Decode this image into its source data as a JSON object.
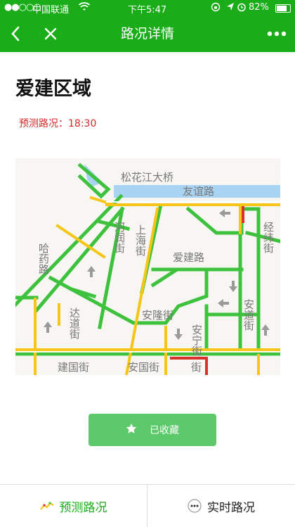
{
  "status_bar": {
    "signal": "●●○○○",
    "carrier": "中国联通",
    "time": "下午5:47",
    "battery": "82%"
  },
  "nav": {
    "title": "路况详情",
    "icons": [
      "back-icon",
      "close-icon",
      "more-icon"
    ]
  },
  "content": {
    "area_title": "爱建区域",
    "forecast_label": "预测路况：",
    "forecast_time": "18:30"
  },
  "map": {
    "labels": {
      "songhuajiang_bridge": "松花江大桥",
      "youyi_road": "友谊路",
      "herun_street": "河润街",
      "shanghai_street": "上海街",
      "aijian_road": "爱建路",
      "jingwei_street": "经纬街",
      "hayao_road": "哈药路",
      "anlong_street": "安隆街",
      "anning_street": "安宁街",
      "andao_street": "安道街",
      "dadao_street": "达道街",
      "jianguo_street": "建国街",
      "anguo_street": "安国街",
      "bottom_street": "街"
    },
    "colors": {
      "free": "#3ec23e",
      "slow": "#f5c518",
      "jam": "#d9312b",
      "river": "#a9d3f2"
    }
  },
  "favorite_button": {
    "label": "已收藏",
    "icon": "star-icon"
  },
  "tabbar": {
    "forecast": "预测路况",
    "realtime": "实时路况"
  }
}
